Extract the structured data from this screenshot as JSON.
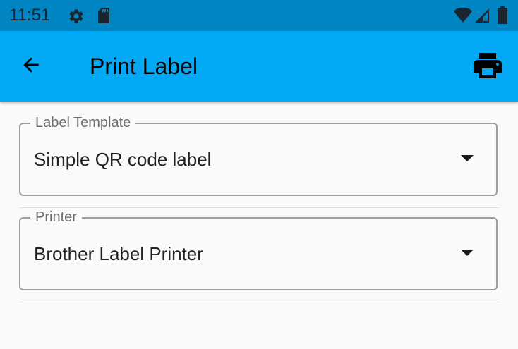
{
  "status_bar": {
    "time": "11:51",
    "icons": [
      "gear-icon",
      "sd-card-icon",
      "wifi-icon",
      "signal-icon",
      "battery-icon"
    ]
  },
  "app_bar": {
    "title": "Print Label",
    "back_icon": "arrow-left-icon",
    "action_icon": "printer-icon"
  },
  "form": {
    "label_template": {
      "label": "Label Template",
      "value": "Simple QR code label"
    },
    "printer": {
      "label": "Printer",
      "value": "Brother Label Printer"
    }
  },
  "colors": {
    "status_bar": "#0185c2",
    "app_bar": "#03a9f4",
    "background": "#fafafa"
  }
}
